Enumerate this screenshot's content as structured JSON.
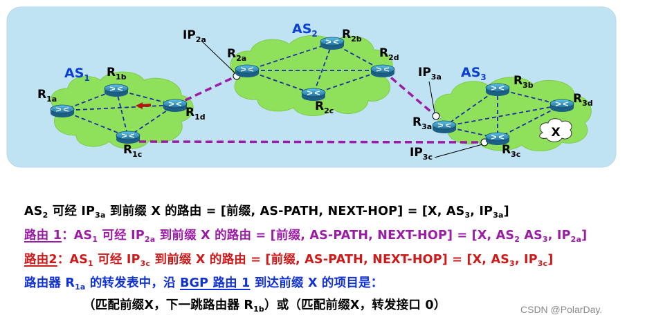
{
  "diagram": {
    "as_labels": {
      "as1": {
        "main": "AS",
        "sub": "1"
      },
      "as2": {
        "main": "AS",
        "sub": "2"
      },
      "as3": {
        "main": "AS",
        "sub": "3"
      }
    },
    "routers": {
      "r1a": {
        "main": "R",
        "sub": "1a"
      },
      "r1b": {
        "main": "R",
        "sub": "1b"
      },
      "r1c": {
        "main": "R",
        "sub": "1c"
      },
      "r1d": {
        "main": "R",
        "sub": "1d"
      },
      "r2a": {
        "main": "R",
        "sub": "2a"
      },
      "r2b": {
        "main": "R",
        "sub": "2b"
      },
      "r2c": {
        "main": "R",
        "sub": "2c"
      },
      "r2d": {
        "main": "R",
        "sub": "2d"
      },
      "r3a": {
        "main": "R",
        "sub": "3a"
      },
      "r3b": {
        "main": "R",
        "sub": "3b"
      },
      "r3c": {
        "main": "R",
        "sub": "3c"
      },
      "r3d": {
        "main": "R",
        "sub": "3d"
      }
    },
    "interfaces": {
      "ip2a": {
        "main": "IP",
        "sub": "2a"
      },
      "ip3a": {
        "main": "IP",
        "sub": "3a"
      },
      "ip3c": {
        "main": "IP",
        "sub": "3c"
      }
    },
    "prefix": "X",
    "colors": {
      "panel": "#bfe3f3",
      "cloud": "#8fe05a",
      "router": "#2d8fb8",
      "ebgp": "#9b1ba6",
      "arrow": "#b2140e"
    }
  },
  "text": {
    "line1": {
      "a": "AS",
      "a_sub": "2",
      "b": " 可经 IP",
      "b_sub": "3a",
      "c": " 到前缀 X 的路由 = [前缀, AS-PATH, NEXT-HOP] = [X, AS",
      "c_sub": "3",
      "d": ", IP",
      "d_sub": "3a",
      "e": "]"
    },
    "line2": {
      "label": "路由 1",
      "a": "：AS",
      "a_sub": "1",
      "b": " 可经 IP",
      "b_sub": "2a",
      "c": " 到前缀 X 的路由 = [前缀, AS-PATH, NEXT-HOP] = [X, AS",
      "c_sub": "2",
      "d": " AS",
      "d_sub": "3",
      "e": ", IP",
      "e_sub": "2a",
      "f": "]"
    },
    "line3": {
      "label": "路由2",
      "a": "：AS",
      "a_sub": "1",
      "b": " 可经 IP",
      "b_sub": "3c",
      "c": " 到前缀 X 的路由 = [前缀, AS-PATH, NEXT-HOP] = [X, AS",
      "c_sub": "3",
      "d": ", IP",
      "d_sub": "3c",
      "e": "]"
    },
    "line4": {
      "a": "路由器 R",
      "a_sub": "1a",
      "b": " 的转发表中，沿 ",
      "link": "BGP 路由 1",
      "c": " 到达前缀 X 的项目是："
    },
    "line5": {
      "a": "（匹配前缀X，下一跳路由器 R",
      "a_sub": "1b",
      "b": "）或（匹配前缀X，转发接口 0）"
    },
    "watermark": "CSDN @PolarDay."
  }
}
